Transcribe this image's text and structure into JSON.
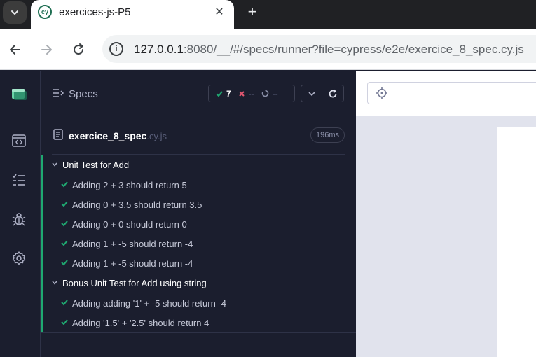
{
  "browser": {
    "tab_title": "exercices-js-P5",
    "tab_close": "✕",
    "new_tab": "+",
    "url_host": "127.0.0.1",
    "url_rest": ":8080/__/#/specs/runner?file=cypress/e2e/exercice_8_spec.cy.js"
  },
  "reporter": {
    "specs_label": "Specs",
    "stats": {
      "passed": "7",
      "failed": "--",
      "pending": "--"
    },
    "spec_file": {
      "name": "exercice_8_spec",
      "ext": ".cy.js",
      "duration": "196ms"
    },
    "suites": [
      {
        "title": "Unit Test for Add",
        "tests": [
          "Adding 2 + 3 should return 5",
          "Adding 0 + 3.5 should return 3.5",
          "Adding 0 + 0 should return 0",
          "Adding 1 + -5 should return -4",
          "Adding 1 + -5 should return -4"
        ]
      },
      {
        "title": "Bonus Unit Test for Add using string",
        "tests": [
          "Adding adding '1' + -5 should return -4",
          "Adding '1.5' + '2.5' should return 4"
        ]
      }
    ]
  },
  "colors": {
    "pass": "#1fa971",
    "fail": "#e45770",
    "panel_bg": "#1b1e2e",
    "tab_bg": "#202124"
  },
  "icons": {
    "nav": [
      "cypress-logo-icon",
      "runs-icon",
      "specs-list-icon",
      "debug-bug-icon",
      "settings-gear-icon"
    ]
  }
}
